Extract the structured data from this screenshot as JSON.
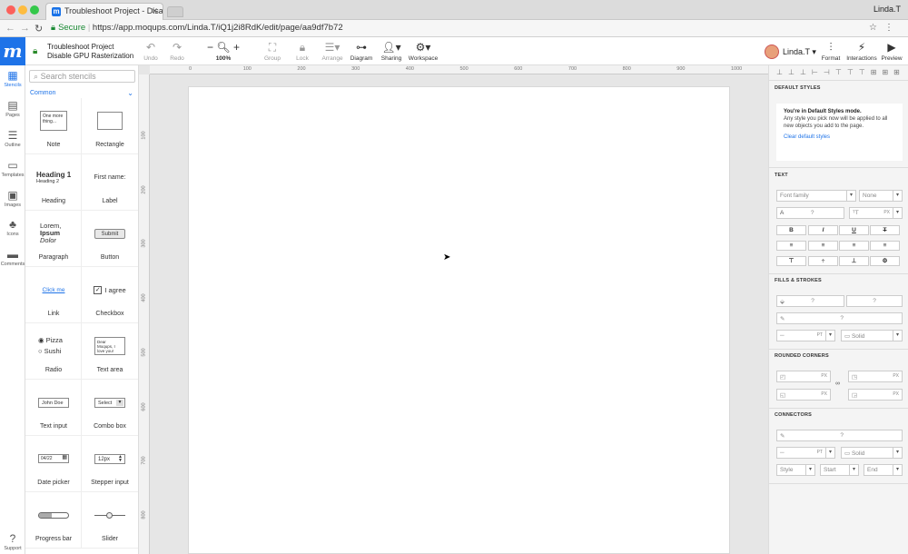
{
  "browser": {
    "tab_title": "Troubleshoot Project - Disable",
    "tab_favicon": "m",
    "user": "Linda.T",
    "secure_label": "Secure",
    "url": "https://app.moqups.com/Linda.T/iQ1j2i8RdK/edit/page/aa9df7b72"
  },
  "header": {
    "logo": "m",
    "project_name": "Troubleshoot Project",
    "project_sub": "Disable GPU Rasterization",
    "undo": "Undo",
    "redo": "Redo",
    "zoom": "100%",
    "group": "Group",
    "lock": "Lock",
    "arrange": "Arrange",
    "diagram": "Diagram",
    "sharing": "Sharing",
    "workspace": "Workspace",
    "user": "Linda.T",
    "format": "Format",
    "interactions": "Interactions",
    "preview": "Preview"
  },
  "rail": [
    {
      "label": "Stencils",
      "icon": "stencils-icon"
    },
    {
      "label": "Pages",
      "icon": "pages-icon"
    },
    {
      "label": "Outline",
      "icon": "outline-icon"
    },
    {
      "label": "Templates",
      "icon": "templates-icon"
    },
    {
      "label": "Images",
      "icon": "images-icon"
    },
    {
      "label": "Icons",
      "icon": "icons-icon"
    },
    {
      "label": "Comments",
      "icon": "comments-icon"
    },
    {
      "label": "Support",
      "icon": "help-icon"
    }
  ],
  "stencils": {
    "search_placeholder": "Search stencils",
    "category": "Common",
    "items": [
      {
        "label": "Note",
        "preview": "One more thing..."
      },
      {
        "label": "Rectangle",
        "preview": ""
      },
      {
        "label": "Heading",
        "preview": "Heading 1",
        "preview2": "Heading 2"
      },
      {
        "label": "Label",
        "preview": "First name:"
      },
      {
        "label": "Paragraph",
        "preview": "Lorem,",
        "preview2": "Ipsum",
        "preview3": "Dolor"
      },
      {
        "label": "Button",
        "preview": "Submit"
      },
      {
        "label": "Link",
        "preview": "Click me"
      },
      {
        "label": "Checkbox",
        "preview": "I agree"
      },
      {
        "label": "Radio",
        "preview": "Pizza",
        "preview2": "Sushi"
      },
      {
        "label": "Text area",
        "preview": "Dear Moqups, I love you!"
      },
      {
        "label": "Text input",
        "preview": "John Doe"
      },
      {
        "label": "Combo box",
        "preview": "Select"
      },
      {
        "label": "Date picker",
        "preview": "04/22"
      },
      {
        "label": "Stepper input",
        "preview": "12px"
      },
      {
        "label": "Progress bar",
        "preview": ""
      },
      {
        "label": "Slider",
        "preview": ""
      }
    ]
  },
  "ruler": {
    "h_ticks": [
      "0",
      "100",
      "200",
      "300",
      "400",
      "500",
      "600",
      "700",
      "800",
      "900",
      "1000"
    ],
    "v_ticks": [
      "100",
      "200",
      "300",
      "400",
      "500",
      "600",
      "700",
      "800"
    ]
  },
  "format_panel": {
    "default_styles_title": "DEFAULT STYLES",
    "default_bold": "You're in Default Styles mode.",
    "default_text": "Any style you pick now will be applied to all new objects you add to the page.",
    "clear_link": "Clear default styles",
    "text_title": "TEXT",
    "font_family": "Font family",
    "font_weight": "None",
    "q": "?",
    "px": "PX",
    "pt": "PT",
    "bold": "B",
    "italic": "I",
    "underline": "U",
    "strike": "T",
    "fills_title": "FILLS & STROKES",
    "solid": "Solid",
    "corners_title": "ROUNDED CORNERS",
    "connectors_title": "CONNECTORS",
    "style": "Style",
    "start": "Start",
    "end": "End"
  }
}
